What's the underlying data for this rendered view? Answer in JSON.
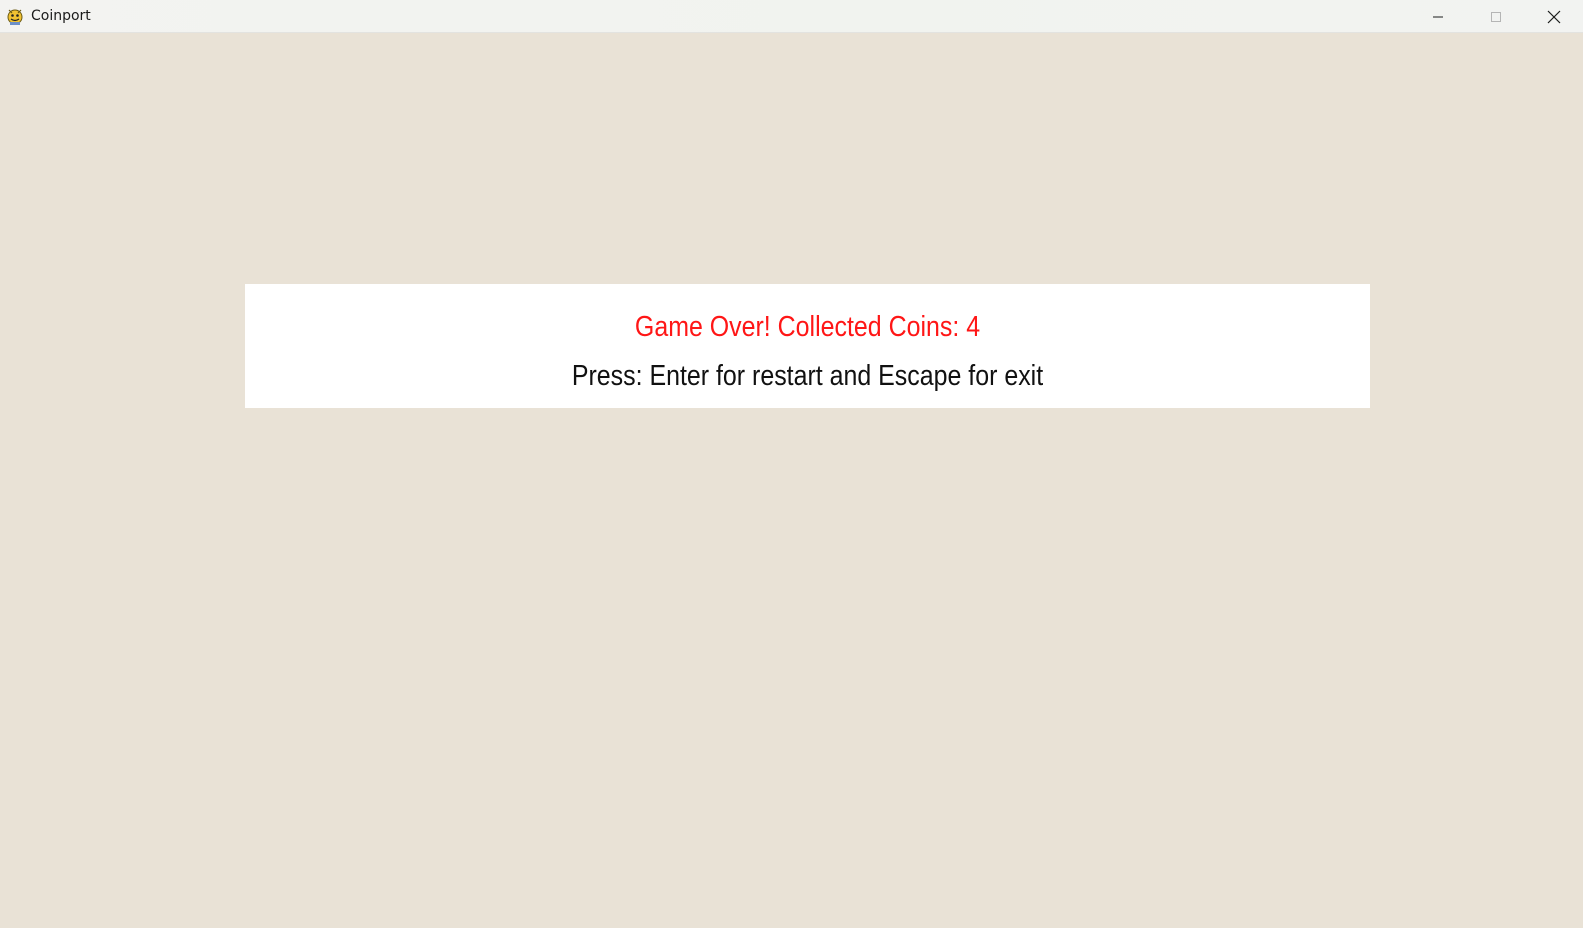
{
  "window": {
    "title": "Coinport",
    "icon": "pygame-snake-icon"
  },
  "controls": {
    "minimize_icon": "minimize-icon",
    "maximize_icon": "maximize-icon",
    "close_icon": "close-icon"
  },
  "game_over_panel": {
    "message": "Game Over! Collected Coins: 4",
    "instructions": "Press: Enter for restart and Escape for exit"
  },
  "colors": {
    "background": "#e9e2d6",
    "panel": "#ffffff",
    "message": "#ff1616",
    "instructions": "#111111"
  }
}
